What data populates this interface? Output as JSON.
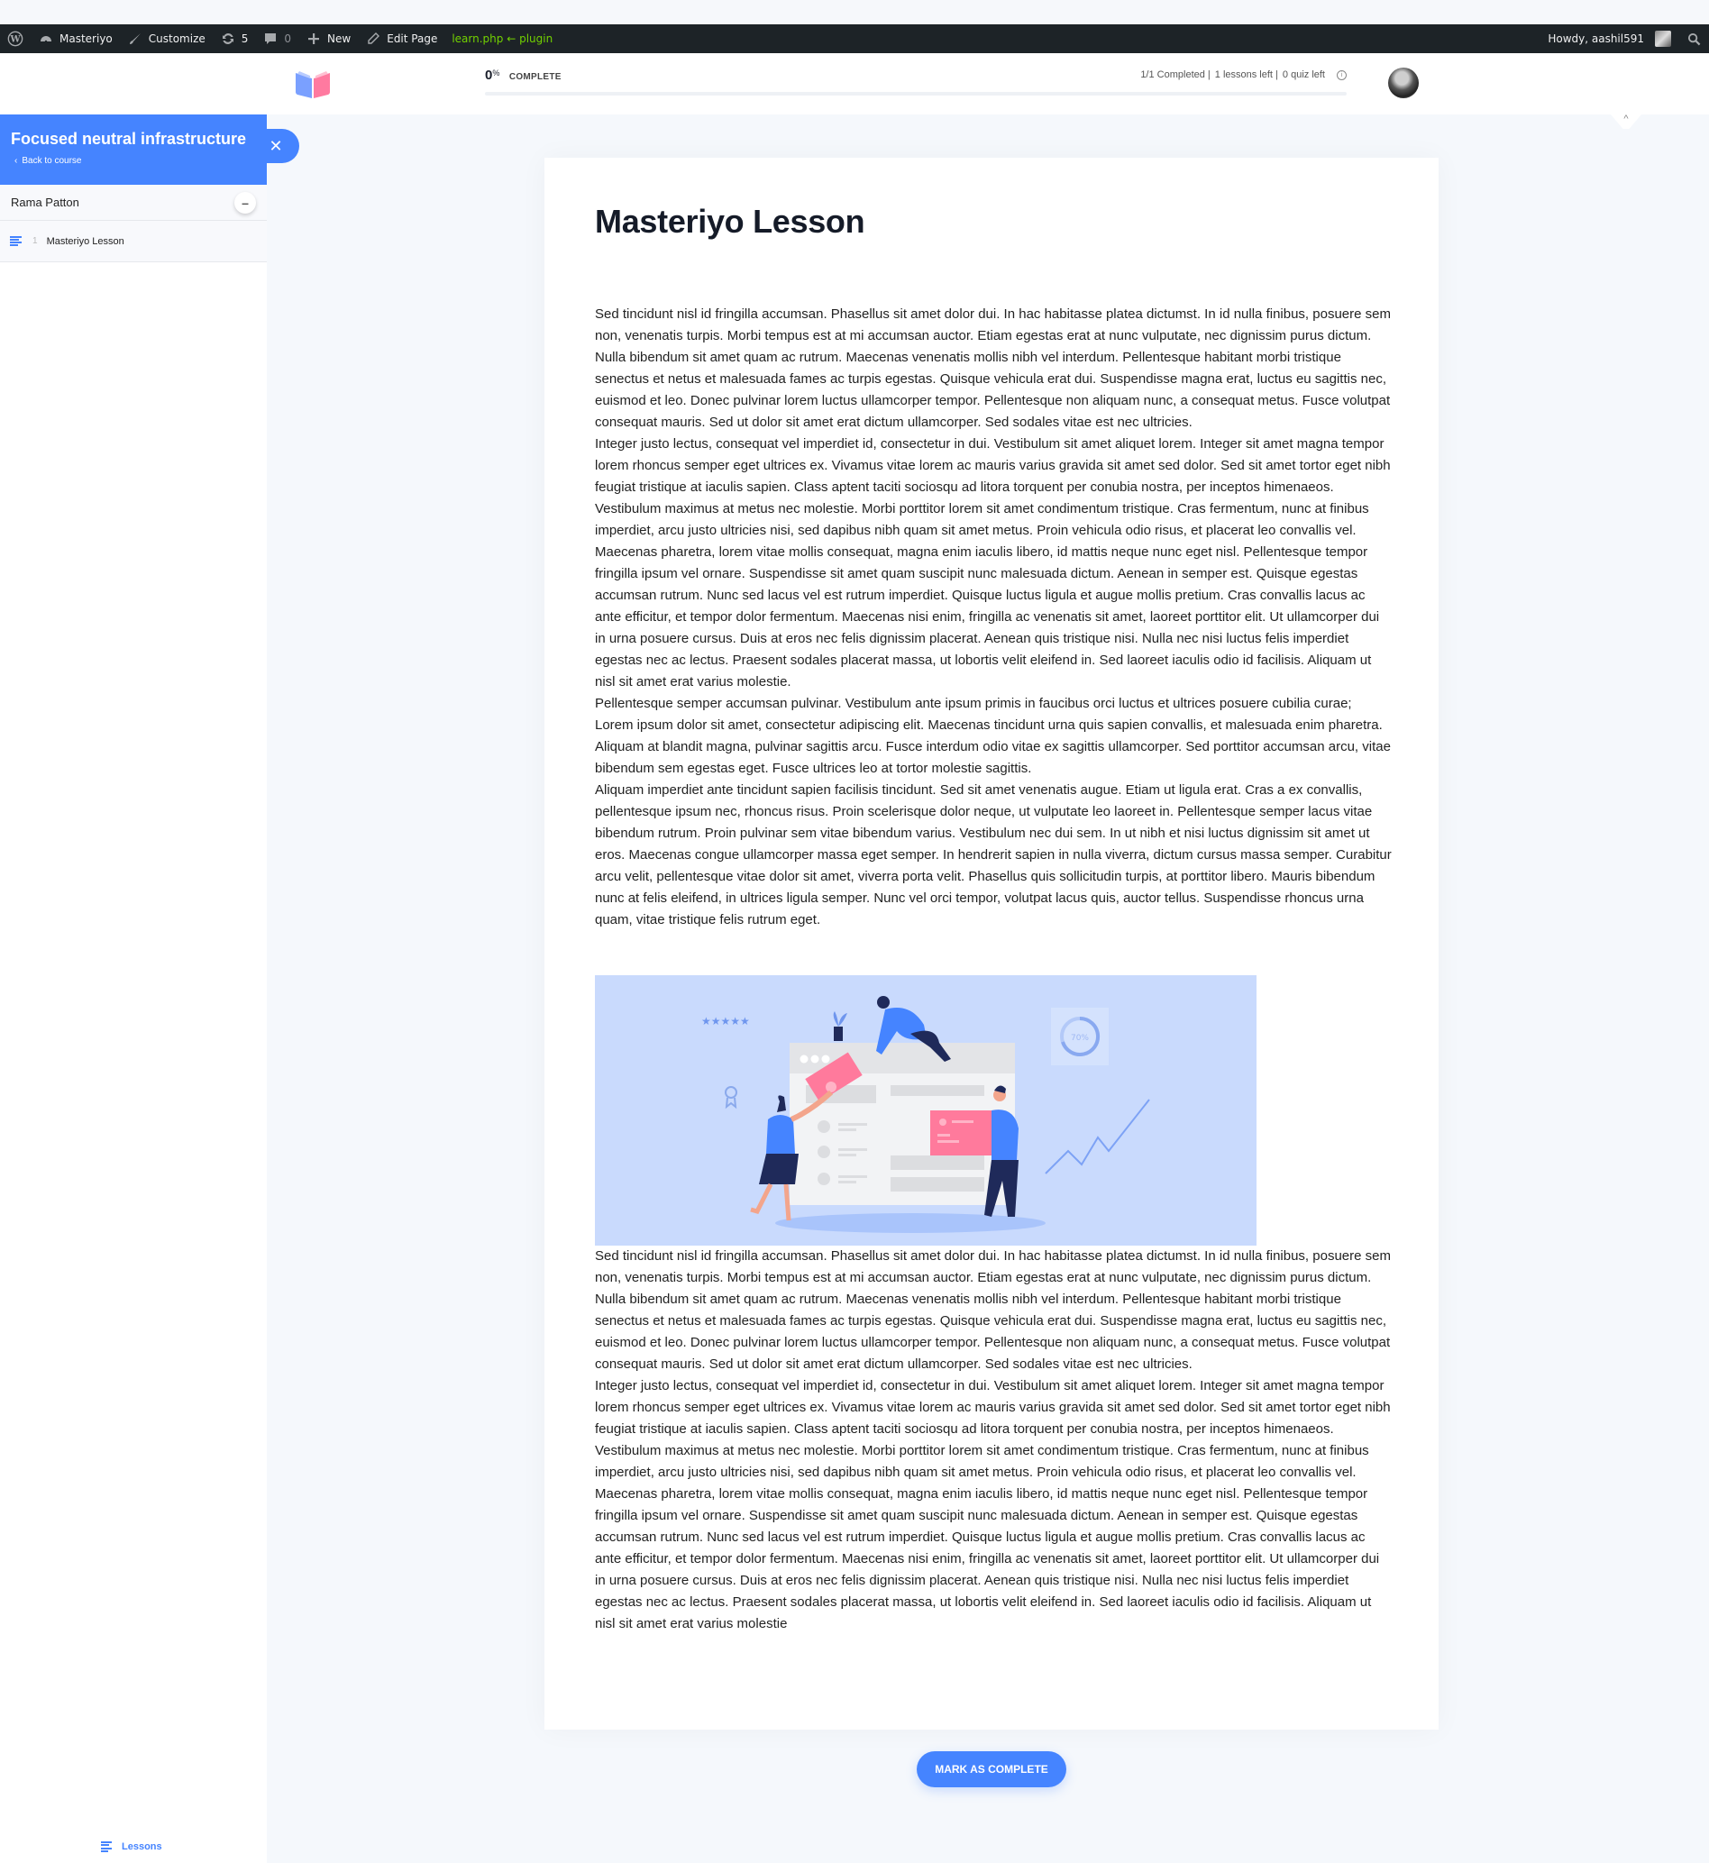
{
  "adminbar": {
    "site_name": "Masteriyo",
    "customize": "Customize",
    "updates_count": "5",
    "comments_count": "0",
    "new": "New",
    "edit_page": "Edit Page",
    "template_hint": "learn.php ← plugin",
    "howdy": "Howdy, aashil591"
  },
  "header": {
    "progress_value": "0",
    "progress_unit": "%",
    "progress_fraction": 0,
    "progress_label": "COMPLETE",
    "completed": "1/1 Completed |",
    "lessons_left": "1 lessons left |",
    "quiz_left": "0 quiz left",
    "accent_color": "#4584ff"
  },
  "sidebar": {
    "course_title": "Focused neutral infrastructure",
    "back_link": "Back to course",
    "section_title": "Rama Patton",
    "lessons": [
      {
        "number": "1",
        "title": "Masteriyo Lesson"
      }
    ],
    "footer_tab": "Lessons"
  },
  "lesson": {
    "title": "Masteriyo Lesson",
    "paragraphs_before_image": [
      "Sed tincidunt nisl id fringilla accumsan. Phasellus sit amet dolor dui. In hac habitasse platea dictumst. In id nulla finibus, posuere sem non, venenatis turpis. Morbi tempus est at mi accumsan auctor. Etiam egestas erat at nunc vulputate, nec dignissim purus dictum. Nulla bibendum sit amet quam ac rutrum. Maecenas venenatis mollis nibh vel interdum. Pellentesque habitant morbi tristique senectus et netus et malesuada fames ac turpis egestas. Quisque vehicula erat dui. Suspendisse magna erat, luctus eu sagittis nec, euismod et leo. Donec pulvinar lorem luctus ullamcorper tempor. Pellentesque non aliquam nunc, a consequat metus. Fusce volutpat consequat mauris. Sed ut dolor sit amet erat dictum ullamcorper. Sed sodales vitae est nec ultricies.",
      "Integer justo lectus, consequat vel imperdiet id, consectetur in dui. Vestibulum sit amet aliquet lorem. Integer sit amet magna tempor lorem rhoncus semper eget ultrices ex. Vivamus vitae lorem ac mauris varius gravida sit amet sed dolor. Sed sit amet tortor eget nibh feugiat tristique at iaculis sapien. Class aptent taciti sociosqu ad litora torquent per conubia nostra, per inceptos himenaeos. Vestibulum maximus at metus nec molestie. Morbi porttitor lorem sit amet condimentum tristique. Cras fermentum, nunc at finibus imperdiet, arcu justo ultricies nisi, sed dapibus nibh quam sit amet metus. Proin vehicula odio risus, et placerat leo convallis vel.",
      "Maecenas pharetra, lorem vitae mollis consequat, magna enim iaculis libero, id mattis neque nunc eget nisl. Pellentesque tempor fringilla ipsum vel ornare. Suspendisse sit amet quam suscipit nunc malesuada dictum. Aenean in semper est. Quisque egestas accumsan rutrum. Nunc sed lacus vel est rutrum imperdiet. Quisque luctus ligula et augue mollis pretium. Cras convallis lacus ac ante efficitur, et tempor dolor fermentum. Maecenas nisi enim, fringilla ac venenatis sit amet, laoreet porttitor elit. Ut ullamcorper dui in urna posuere cursus. Duis at eros nec felis dignissim placerat. Aenean quis tristique nisi. Nulla nec nisi luctus felis imperdiet egestas nec ac lectus. Praesent sodales placerat massa, ut lobortis velit eleifend in. Sed laoreet iaculis odio id facilisis. Aliquam ut nisl sit amet erat varius molestie.",
      "Pellentesque semper accumsan pulvinar. Vestibulum ante ipsum primis in faucibus orci luctus et ultrices posuere cubilia curae; Lorem ipsum dolor sit amet, consectetur adipiscing elit. Maecenas tincidunt urna quis sapien convallis, et malesuada enim pharetra. Aliquam at blandit magna, pulvinar sagittis arcu. Fusce interdum odio vitae ex sagittis ullamcorper. Sed porttitor accumsan arcu, vitae bibendum sem egestas eget. Fusce ultrices leo at tortor molestie sagittis.",
      "Aliquam imperdiet ante tincidunt sapien facilisis tincidunt. Sed sit amet venenatis augue. Etiam ut ligula erat. Cras a ex convallis, pellentesque ipsum nec, rhoncus risus. Proin scelerisque dolor neque, ut vulputate leo laoreet in. Pellentesque semper lacus vitae bibendum rutrum. Proin pulvinar sem vitae bibendum varius. Vestibulum nec dui sem. In ut nibh et nisi luctus dignissim sit amet ut eros. Maecenas congue ullamcorper massa eget semper. In hendrerit sapien in nulla viverra, dictum cursus massa semper. Curabitur arcu velit, pellentesque vitae dolor sit amet, viverra porta velit. Phasellus quis sollicitudin turpis, at porttitor libero. Mauris bibendum nunc at felis eleifend, in ultrices ligula semper. Nunc vel orci tempor, volutpat lacus quis, auctor tellus. Suspendisse rhoncus urna quam, vitae tristique felis rutrum eget."
    ],
    "illustration": {
      "description": "team-collaboration-illustration",
      "badge_text": "70%",
      "bg_color": "#c9dafd"
    },
    "paragraphs_after_image": [
      "Sed tincidunt nisl id fringilla accumsan. Phasellus sit amet dolor dui. In hac habitasse platea dictumst. In id nulla finibus, posuere sem non, venenatis turpis. Morbi tempus est at mi accumsan auctor. Etiam egestas erat at nunc vulputate, nec dignissim purus dictum. Nulla bibendum sit amet quam ac rutrum. Maecenas venenatis mollis nibh vel interdum. Pellentesque habitant morbi tristique senectus et netus et malesuada fames ac turpis egestas. Quisque vehicula erat dui. Suspendisse magna erat, luctus eu sagittis nec, euismod et leo. Donec pulvinar lorem luctus ullamcorper tempor. Pellentesque non aliquam nunc, a consequat metus. Fusce volutpat consequat mauris. Sed ut dolor sit amet erat dictum ullamcorper. Sed sodales vitae est nec ultricies.",
      "Integer justo lectus, consequat vel imperdiet id, consectetur in dui. Vestibulum sit amet aliquet lorem. Integer sit amet magna tempor lorem rhoncus semper eget ultrices ex. Vivamus vitae lorem ac mauris varius gravida sit amet sed dolor. Sed sit amet tortor eget nibh feugiat tristique at iaculis sapien. Class aptent taciti sociosqu ad litora torquent per conubia nostra, per inceptos himenaeos. Vestibulum maximus at metus nec molestie. Morbi porttitor lorem sit amet condimentum tristique. Cras fermentum, nunc at finibus imperdiet, arcu justo ultricies nisi, sed dapibus nibh quam sit amet metus. Proin vehicula odio risus, et placerat leo convallis vel.",
      "Maecenas pharetra, lorem vitae mollis consequat, magna enim iaculis libero, id mattis neque nunc eget nisl. Pellentesque tempor fringilla ipsum vel ornare. Suspendisse sit amet quam suscipit nunc malesuada dictum. Aenean in semper est. Quisque egestas accumsan rutrum. Nunc sed lacus vel est rutrum imperdiet. Quisque luctus ligula et augue mollis pretium. Cras convallis lacus ac ante efficitur, et tempor dolor fermentum. Maecenas nisi enim, fringilla ac venenatis sit amet, laoreet porttitor elit. Ut ullamcorper dui in urna posuere cursus. Duis at eros nec felis dignissim placerat. Aenean quis tristique nisi. Nulla nec nisi luctus felis imperdiet egestas nec ac lectus. Praesent sodales placerat massa, ut lobortis velit eleifend in. Sed laoreet iaculis odio id facilisis. Aliquam ut nisl sit amet erat varius molestie"
    ]
  },
  "actions": {
    "mark_complete": "MARK AS COMPLETE"
  }
}
